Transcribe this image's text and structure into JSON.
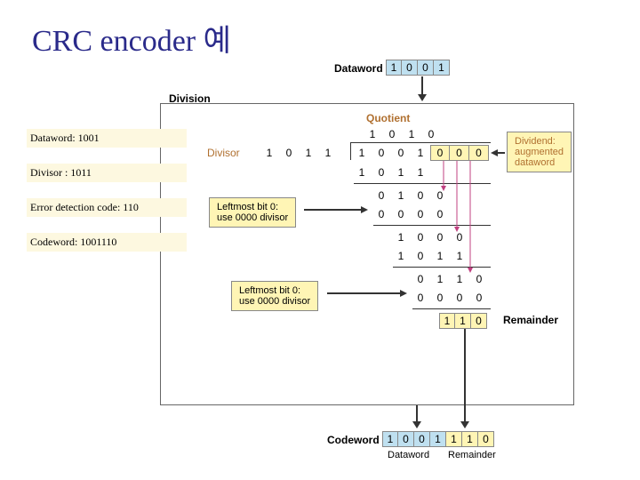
{
  "title": "CRC encoder 예",
  "dataword_label": "Dataword",
  "dataword_bits": [
    "1",
    "0",
    "0",
    "1"
  ],
  "division_label": "Division",
  "quotient_label": "Quotient",
  "quotient_bits": [
    "1",
    "0",
    "1",
    "0"
  ],
  "divisor_label": "Divisor",
  "divisor_bits": [
    "1",
    "0",
    "1",
    "1"
  ],
  "dividend_bits": [
    "1",
    "0",
    "0",
    "1",
    "0",
    "0",
    "0"
  ],
  "calc": {
    "r1": [
      "1",
      "0",
      "1",
      "1"
    ],
    "r2": [
      "0",
      "1",
      "0",
      "0"
    ],
    "r3": [
      "0",
      "0",
      "0",
      "0"
    ],
    "r4": [
      "1",
      "0",
      "0",
      "0"
    ],
    "r5": [
      "1",
      "0",
      "1",
      "1"
    ],
    "r6": [
      "0",
      "1",
      "1",
      "0"
    ],
    "r7": [
      "0",
      "0",
      "0",
      "0"
    ]
  },
  "remainder_bits": [
    "1",
    "1",
    "0"
  ],
  "remainder_label": "Remainder",
  "tag1_a": "Leftmost bit 0:",
  "tag1_b": "use 0000 divisor",
  "tag2_a": "Leftmost bit 0:",
  "tag2_b": "use 0000 divisor",
  "divtag_a": "Dividend:",
  "divtag_b": "augmented",
  "divtag_c": "dataword",
  "info": {
    "l1": "Dataword: 1001",
    "l2": "Divisor : 1011",
    "l3": "Error detection code: 110",
    "l4": "Codeword: 1001110"
  },
  "codeword_label": "Codeword",
  "codeword_bits": [
    "1",
    "0",
    "0",
    "1",
    "1",
    "1",
    "0"
  ],
  "cw_sub1": "Dataword",
  "cw_sub2": "Remainder"
}
